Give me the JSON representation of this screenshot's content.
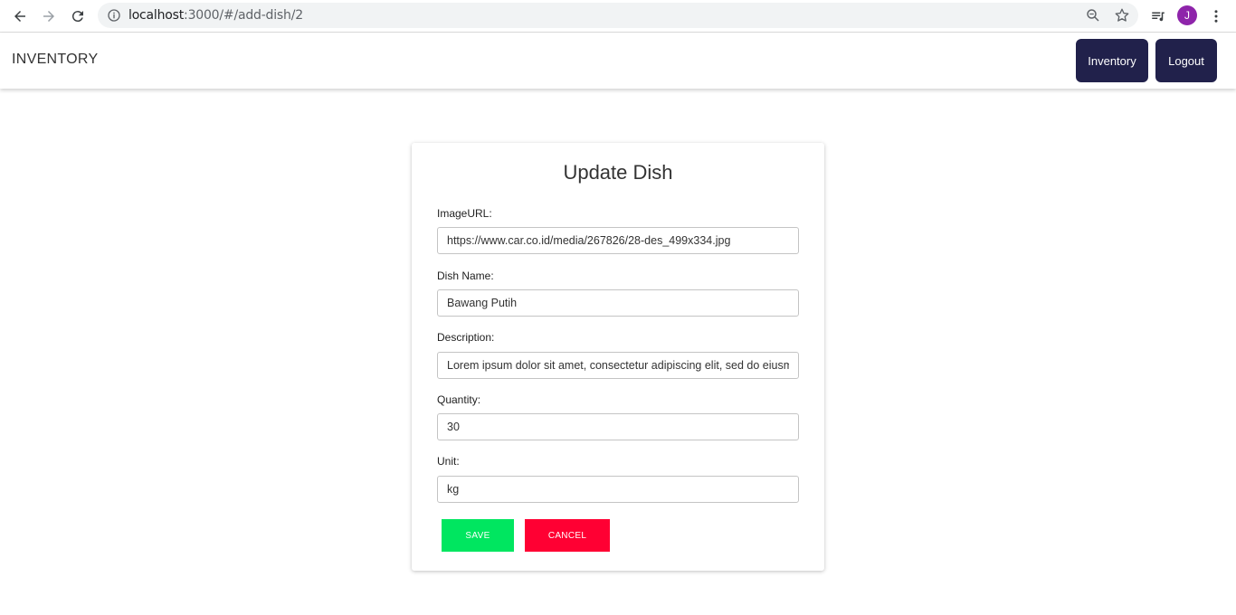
{
  "browser": {
    "url_host": "localhost",
    "url_rest": ":3000/#/add-dish/2",
    "profile_initial": "J"
  },
  "header": {
    "brand": "INVENTORY",
    "nav": {
      "inventory_label": "Inventory",
      "logout_label": "Logout"
    }
  },
  "form": {
    "title": "Update Dish",
    "fields": {
      "image_url": {
        "label": "ImageURL:",
        "value": "https://www.car.co.id/media/267826/28-des_499x334.jpg"
      },
      "dish_name": {
        "label": "Dish Name:",
        "value": "Bawang Putih"
      },
      "description": {
        "label": "Description:",
        "value": "Lorem ipsum dolor sit amet, consectetur adipiscing elit, sed do eiusmod tempor incididunt ut labore et dolore magna aliqua."
      },
      "quantity": {
        "label": "Quantity:",
        "value": "30"
      },
      "unit": {
        "label": "Unit:",
        "value": "kg"
      }
    },
    "save_label": "SAVE",
    "cancel_label": "CANCEL"
  },
  "colors": {
    "nav_button_bg": "#21214b",
    "save_button_bg": "#00e660",
    "cancel_button_bg": "#ff0033",
    "profile_avatar_bg": "#8e24aa"
  },
  "icons": [
    "back-arrow-icon",
    "forward-arrow-icon",
    "reload-icon",
    "info-icon",
    "zoom-icon",
    "star-icon",
    "media-playlist-icon",
    "more-vert-icon"
  ]
}
